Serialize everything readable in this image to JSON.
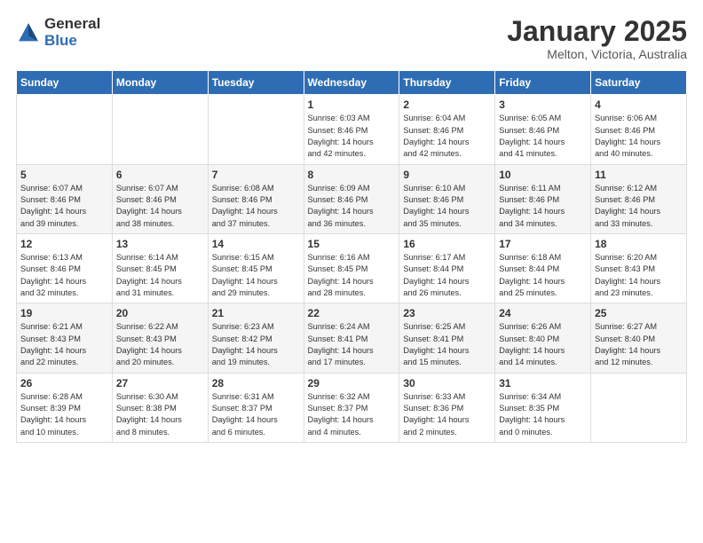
{
  "header": {
    "logo_general": "General",
    "logo_blue": "Blue",
    "title": "January 2025",
    "subtitle": "Melton, Victoria, Australia"
  },
  "days_of_week": [
    "Sunday",
    "Monday",
    "Tuesday",
    "Wednesday",
    "Thursday",
    "Friday",
    "Saturday"
  ],
  "weeks": [
    [
      {
        "day": "",
        "content": ""
      },
      {
        "day": "",
        "content": ""
      },
      {
        "day": "",
        "content": ""
      },
      {
        "day": "1",
        "content": "Sunrise: 6:03 AM\nSunset: 8:46 PM\nDaylight: 14 hours\nand 42 minutes."
      },
      {
        "day": "2",
        "content": "Sunrise: 6:04 AM\nSunset: 8:46 PM\nDaylight: 14 hours\nand 42 minutes."
      },
      {
        "day": "3",
        "content": "Sunrise: 6:05 AM\nSunset: 8:46 PM\nDaylight: 14 hours\nand 41 minutes."
      },
      {
        "day": "4",
        "content": "Sunrise: 6:06 AM\nSunset: 8:46 PM\nDaylight: 14 hours\nand 40 minutes."
      }
    ],
    [
      {
        "day": "5",
        "content": "Sunrise: 6:07 AM\nSunset: 8:46 PM\nDaylight: 14 hours\nand 39 minutes."
      },
      {
        "day": "6",
        "content": "Sunrise: 6:07 AM\nSunset: 8:46 PM\nDaylight: 14 hours\nand 38 minutes."
      },
      {
        "day": "7",
        "content": "Sunrise: 6:08 AM\nSunset: 8:46 PM\nDaylight: 14 hours\nand 37 minutes."
      },
      {
        "day": "8",
        "content": "Sunrise: 6:09 AM\nSunset: 8:46 PM\nDaylight: 14 hours\nand 36 minutes."
      },
      {
        "day": "9",
        "content": "Sunrise: 6:10 AM\nSunset: 8:46 PM\nDaylight: 14 hours\nand 35 minutes."
      },
      {
        "day": "10",
        "content": "Sunrise: 6:11 AM\nSunset: 8:46 PM\nDaylight: 14 hours\nand 34 minutes."
      },
      {
        "day": "11",
        "content": "Sunrise: 6:12 AM\nSunset: 8:46 PM\nDaylight: 14 hours\nand 33 minutes."
      }
    ],
    [
      {
        "day": "12",
        "content": "Sunrise: 6:13 AM\nSunset: 8:46 PM\nDaylight: 14 hours\nand 32 minutes."
      },
      {
        "day": "13",
        "content": "Sunrise: 6:14 AM\nSunset: 8:45 PM\nDaylight: 14 hours\nand 31 minutes."
      },
      {
        "day": "14",
        "content": "Sunrise: 6:15 AM\nSunset: 8:45 PM\nDaylight: 14 hours\nand 29 minutes."
      },
      {
        "day": "15",
        "content": "Sunrise: 6:16 AM\nSunset: 8:45 PM\nDaylight: 14 hours\nand 28 minutes."
      },
      {
        "day": "16",
        "content": "Sunrise: 6:17 AM\nSunset: 8:44 PM\nDaylight: 14 hours\nand 26 minutes."
      },
      {
        "day": "17",
        "content": "Sunrise: 6:18 AM\nSunset: 8:44 PM\nDaylight: 14 hours\nand 25 minutes."
      },
      {
        "day": "18",
        "content": "Sunrise: 6:20 AM\nSunset: 8:43 PM\nDaylight: 14 hours\nand 23 minutes."
      }
    ],
    [
      {
        "day": "19",
        "content": "Sunrise: 6:21 AM\nSunset: 8:43 PM\nDaylight: 14 hours\nand 22 minutes."
      },
      {
        "day": "20",
        "content": "Sunrise: 6:22 AM\nSunset: 8:43 PM\nDaylight: 14 hours\nand 20 minutes."
      },
      {
        "day": "21",
        "content": "Sunrise: 6:23 AM\nSunset: 8:42 PM\nDaylight: 14 hours\nand 19 minutes."
      },
      {
        "day": "22",
        "content": "Sunrise: 6:24 AM\nSunset: 8:41 PM\nDaylight: 14 hours\nand 17 minutes."
      },
      {
        "day": "23",
        "content": "Sunrise: 6:25 AM\nSunset: 8:41 PM\nDaylight: 14 hours\nand 15 minutes."
      },
      {
        "day": "24",
        "content": "Sunrise: 6:26 AM\nSunset: 8:40 PM\nDaylight: 14 hours\nand 14 minutes."
      },
      {
        "day": "25",
        "content": "Sunrise: 6:27 AM\nSunset: 8:40 PM\nDaylight: 14 hours\nand 12 minutes."
      }
    ],
    [
      {
        "day": "26",
        "content": "Sunrise: 6:28 AM\nSunset: 8:39 PM\nDaylight: 14 hours\nand 10 minutes."
      },
      {
        "day": "27",
        "content": "Sunrise: 6:30 AM\nSunset: 8:38 PM\nDaylight: 14 hours\nand 8 minutes."
      },
      {
        "day": "28",
        "content": "Sunrise: 6:31 AM\nSunset: 8:37 PM\nDaylight: 14 hours\nand 6 minutes."
      },
      {
        "day": "29",
        "content": "Sunrise: 6:32 AM\nSunset: 8:37 PM\nDaylight: 14 hours\nand 4 minutes."
      },
      {
        "day": "30",
        "content": "Sunrise: 6:33 AM\nSunset: 8:36 PM\nDaylight: 14 hours\nand 2 minutes."
      },
      {
        "day": "31",
        "content": "Sunrise: 6:34 AM\nSunset: 8:35 PM\nDaylight: 14 hours\nand 0 minutes."
      },
      {
        "day": "",
        "content": ""
      }
    ]
  ]
}
